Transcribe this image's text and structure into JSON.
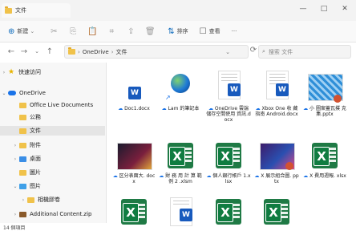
{
  "window": {
    "title": "文件",
    "controls": [
      "—",
      "□",
      "✕"
    ]
  },
  "toolbar": {
    "new_label": "新建",
    "new_chevron": "⌄",
    "sort_label": "排序",
    "view_label": "查看",
    "more_label": "···",
    "icons": {
      "new": "⊕",
      "cut": "✂",
      "copy": "⎘",
      "paste": "📋",
      "rename": "⌗",
      "share": "⇪",
      "delete": "🗑",
      "sort": "⇅",
      "view": "☐"
    }
  },
  "nav": {
    "back": "←",
    "forward": "→",
    "recent": "⌄",
    "up": "↑",
    "refresh": "⟳"
  },
  "address": {
    "crumb_1": "OneDrive",
    "crumb_2": "文件",
    "sep": "›",
    "dropdown": "⌄"
  },
  "search": {
    "placeholder": "搜索 文件",
    "icon": "⌕"
  },
  "sidebar": {
    "items": [
      {
        "label": "快速访问",
        "icon": "star"
      },
      {
        "label": "OneDrive",
        "icon": "cloud"
      },
      {
        "label": "Office Live Documents",
        "icon": "folder"
      },
      {
        "label": "公務",
        "icon": "folder"
      },
      {
        "label": "文件",
        "icon": "folder",
        "selected": true
      },
      {
        "label": "附件",
        "icon": "folder"
      },
      {
        "label": "桌面",
        "icon": "folder"
      },
      {
        "label": "圖片",
        "icon": "folder"
      },
      {
        "label": "图片",
        "icon": "folder"
      },
      {
        "label": "相機膠卷",
        "icon": "folder"
      },
      {
        "label": "Additional Content.zip",
        "icon": "zip"
      }
    ]
  },
  "files": [
    {
      "name": "Doc1.docx",
      "kind": "word"
    },
    {
      "name": "Lam 的筆記本",
      "kind": "notebook"
    },
    {
      "name": "OneDrive 雲端 儲存空間使用 資訊.docx",
      "kind": "word"
    },
    {
      "name": "Xbox One 收 藏 指南 Android.docx",
      "kind": "word"
    },
    {
      "name": "小 圖案蓋瓦撲 克集.pptx",
      "kind": "photo"
    },
    {
      "name": "区分表面大. docx",
      "kind": "photo"
    },
    {
      "name": "財 務 用 計 算 範例 2 .xlsm",
      "kind": "excel"
    },
    {
      "name": "個人銀行帳戶 1.xlsx",
      "kind": "excel"
    },
    {
      "name": "X 展示組合圖. pptx",
      "kind": "photo"
    },
    {
      "name": "X 費用週報. xlsx",
      "kind": "excel"
    },
    {
      "name": "",
      "kind": "excel"
    },
    {
      "name": "",
      "kind": "word"
    },
    {
      "name": "",
      "kind": "excel"
    },
    {
      "name": "",
      "kind": "excel"
    }
  ],
  "status": {
    "count": "14 個項目"
  }
}
